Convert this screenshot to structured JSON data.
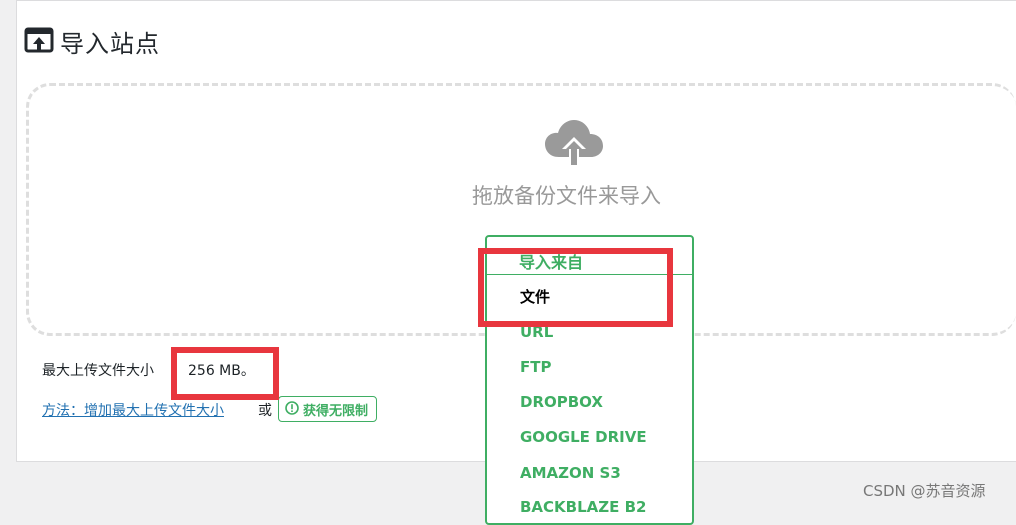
{
  "page": {
    "title": "导入站点",
    "title_icon": "import-upload-icon"
  },
  "dropzone": {
    "icon": "cloud-upload-icon",
    "text": "拖放备份文件来导入"
  },
  "import_menu": {
    "header_label": "导入来自",
    "items": [
      {
        "label": "文件",
        "selected": true
      },
      {
        "label": "URL"
      },
      {
        "label": "FTP"
      },
      {
        "label": "DROPBOX"
      },
      {
        "label": "GOOGLE DRIVE"
      },
      {
        "label": "AMAZON S3"
      },
      {
        "label": "BACKBLAZE B2"
      }
    ]
  },
  "upload_limit": {
    "label": "最大上传文件大小",
    "value": "256 MB。"
  },
  "help": {
    "link_text": "方法：增加最大上传文件大小",
    "or_text": "或",
    "unlimited_label": "获得无限制",
    "unlimited_icon": "info-circle-icon"
  },
  "watermark": "CSDN @苏音资源",
  "colors": {
    "accent_green": "#3fae63",
    "highlight_red": "#e8363e",
    "link_blue": "#2271b1",
    "muted_gray": "#999999"
  }
}
